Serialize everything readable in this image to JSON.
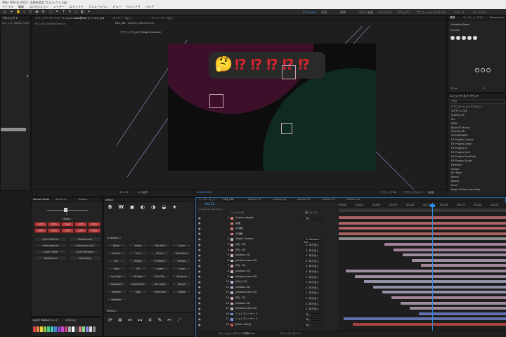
{
  "app": {
    "title": "After Effects 2023 - 名称未設定プロジェクト.aep",
    "menu": [
      "ファイル",
      "編集",
      "コンポジション",
      "レイヤー",
      "エフェクト",
      "アニメーション",
      "ビュー",
      "ウィンドウ",
      "ヘルプ"
    ],
    "workspaces": [
      "デフォルト",
      "学習",
      "標準",
      "小さい画面",
      "ライブラリ",
      "エフェクト",
      "アニメーション",
      "テキスト",
      "ペイント",
      "モーション"
    ],
    "active_workspace": "デフォルト"
  },
  "left_panel": {
    "tab": "プロジェクト",
    "path": "c01_c01_balloon-item-01"
  },
  "viewer": {
    "tabs": [
      "エフェクトコントロール balloon-item-01",
      "コンポジション c01_c01",
      "レイヤー（なし）",
      "フッテージ（なし）"
    ],
    "sub_tabs": [
      "c01_c01",
      "balloon-01",
      "balloon-bg"
    ],
    "camera_label": "アクティブカメラ (Target Camera)",
    "bubble_emoji": "🤔",
    "bubble_marks": [
      "⁉",
      "⁉",
      "⁉",
      "⁉",
      "⁉"
    ],
    "zoom": "33.3 %",
    "quality": "1/4 画質",
    "timecode": "0:00:00:00",
    "renderer": "クラシック3D",
    "view": "アクティブカメラ",
    "views_count": "1画面"
  },
  "right_panel": {
    "tabs": [
      "情報",
      "オーディオ",
      "ブラシ",
      "Wrap_items"
    ],
    "font": "Helvetica Neue",
    "font_style": "Regular",
    "size": "12 px",
    "tracking": "0",
    "effects_tab": "エフェクト＆プリセット",
    "search_placeholder": "検索",
    "effects": [
      "* アニメーションプリセット",
      "3D チャンネル",
      "Andrew FX",
      "Arc",
      "BSPA",
      "Boris FX Mocha",
      "Cinema 4D",
      "CROSSPHERE",
      "FX Plugins-Chanel",
      "FX Plugins-Draw",
      "FX Plugins-Fx",
      "FX Plugins-Font",
      "FX Plugins-FaceFlow",
      "FX Plugins-Script",
      "Freeform",
      "Hands",
      "Jitz Tools",
      "Kamui",
      "Kikaku",
      "Knoll",
      "Magic Bullet Looks Free"
    ]
  },
  "motion_panel": {
    "tabs": [
      "Motion Mode",
      "Shortcut",
      "Toolbox"
    ],
    "value": "0",
    "bottom_label": "Apply",
    "red_row_count": 10,
    "buttons": [
      "Quick Bounce",
      "Rubberband",
      "Interpolate In",
      "Interpolate Out",
      "Quick Falloff",
      "Quick Rotation",
      "Nullbounce",
      "Nullspring"
    ]
  },
  "fx_panel": {
    "tab": "Effect",
    "icons": [
      "B",
      "W",
      "◼",
      "◐",
      "◑",
      "◒",
      "★"
    ],
    "tools_tab": "ft-Toolbar 2",
    "tools": [
      "Move",
      "Break",
      "Obj Shift",
      "Clone",
      "Centre",
      "Grid",
      "Mirror",
      "Keyframes",
      "Kill",
      "Merge",
      "Ft Home",
      "Hit Box",
      "Crop",
      "Fill",
      "Invert",
      "Level",
      "Lm Align",
      "Lft Align",
      "Rnt Tile",
      "Shortcut",
      "Attributes",
      "Spt Rollme",
      "Bar Right",
      "Merge",
      "Mstrleft",
      "Stop",
      "TimeCode",
      "Textbl",
      "Findexer"
    ],
    "tools2_tab": "Effect 2"
  },
  "timeline": {
    "tabs": [
      "レンダーキュー",
      "c01_c01",
      "balloon-01",
      "balloon-bg",
      "balloon-02",
      "balloon-03",
      "balloon-04"
    ],
    "timecode": "00132",
    "fps": "0:00:02:12 (24.00 fps)",
    "column_layer_name": "レイヤー名",
    "column_parent": "親とリンク",
    "ruler": [
      "00000",
      "00025",
      "00050",
      "00075",
      "00100",
      "00125",
      "00150",
      "00175",
      "00200",
      "00225"
    ],
    "layers": [
      {
        "num": "1",
        "name": "Camera target",
        "color": "#d97a7a",
        "mode": "なし"
      },
      {
        "num": "",
        "name": "変換",
        "color": "#d97a7a",
        "mode": ""
      },
      {
        "num": "",
        "name": "X 回転",
        "color": "#d97a7a",
        "mode": ""
      },
      {
        "num": "",
        "name": "Z 回転",
        "color": "#d97a7a",
        "mode": ""
      },
      {
        "num": "2",
        "name": "Target Camera",
        "color": "#b3b3b3",
        "mode": "1. Camera tar"
      },
      {
        "num": "3",
        "name": "[吹]- 02]",
        "color": "#d3a3c0",
        "mode": "2. 吹き出し"
      },
      {
        "num": "4",
        "name": "[吹]- 03]",
        "color": "#d3a3c0",
        "mode": "2. 吹き出し"
      },
      {
        "num": "5",
        "name": "[balloon-01]",
        "color": "#c9b0c9",
        "mode": "2. 吹き出し"
      },
      {
        "num": "6",
        "name": "[balloon-item-02]",
        "color": "#c9b0c9",
        "mode": "2. 吹き出し"
      },
      {
        "num": "7",
        "name": "[吹]- 02]",
        "color": "#d3a3c0",
        "mode": "2. 吹き出し"
      },
      {
        "num": "8",
        "name": "[balloon-03]",
        "color": "#c9b0c9",
        "mode": "2. 吹き出し"
      },
      {
        "num": "9",
        "name": "[balloon-item-03]",
        "color": "#c9b0c9",
        "mode": "2. 吹き出し"
      },
      {
        "num": "10",
        "name": "[Obj]- 02]",
        "color": "#b7b7d6",
        "mode": "2. 吹き出し"
      },
      {
        "num": "11",
        "name": "[balloon-02]",
        "color": "#b7b7d6",
        "mode": "2. 吹き出し"
      },
      {
        "num": "12",
        "name": "[balloon-item-02]",
        "color": "#b7b7d6",
        "mode": "2. 吹き出し"
      },
      {
        "num": "13",
        "name": "[吹]- 02]",
        "color": "#d3a3c0",
        "mode": "2. 吹き出し"
      },
      {
        "num": "14",
        "name": "[balloon-01]",
        "color": "#c9b0c9",
        "mode": "2. 吹き出し"
      },
      {
        "num": "15",
        "name": "[balloon-item-01]",
        "color": "#c9b0c9",
        "mode": "2. 吹き出し"
      },
      {
        "num": "16",
        "name": "シェイプレイヤー 1",
        "color": "#7b8ee0",
        "mode": "なし"
      },
      {
        "num": "17",
        "name": "シェイプレイヤー 2",
        "color": "#7b8ee0",
        "mode": "なし"
      },
      {
        "num": "18",
        "name": "[Black Solid]",
        "color": "#d14e4e",
        "mode": "なし"
      }
    ],
    "footer": "フレームレンダリング時間  0ms",
    "footer_mode": "スイッチ / モード"
  },
  "bottom_left": {
    "title": "Layer Toolbar 1.1.0",
    "tab2": "Settings"
  },
  "colors": {
    "accent": "#2d8ceb",
    "viewer_bg": "#0d0d0d",
    "magenta": "#4a1030",
    "green": "#0f2a20"
  }
}
